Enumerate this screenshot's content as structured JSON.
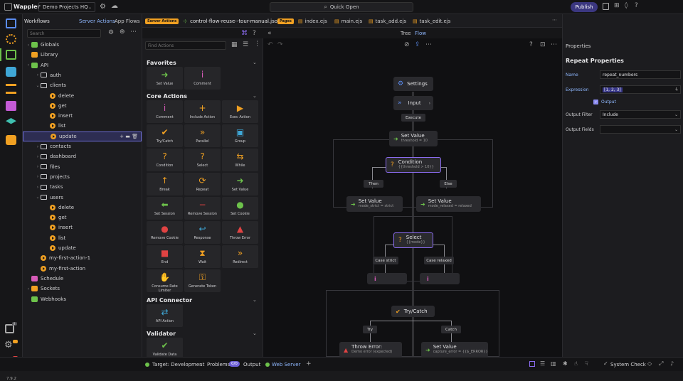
{
  "app": {
    "name": "Wappler",
    "project": "Demo Projects HQ",
    "quick_open": "Quick Open",
    "publish": "Publish",
    "version": "7.9.2"
  },
  "workflows": {
    "title": "Workflows",
    "tab_server": "Server Actions",
    "tab_flows": "App Flows",
    "search_placeholder": "Search",
    "tree": [
      {
        "label": "Globals",
        "kind": "globals",
        "depth": 0
      },
      {
        "label": "Library",
        "kind": "library",
        "depth": 0
      },
      {
        "label": "API",
        "kind": "api",
        "depth": 0
      },
      {
        "label": "auth",
        "kind": "folder",
        "depth": 1
      },
      {
        "label": "clients",
        "kind": "folder",
        "depth": 1
      },
      {
        "label": "delete",
        "kind": "action",
        "depth": 2
      },
      {
        "label": "get",
        "kind": "action",
        "depth": 2
      },
      {
        "label": "insert",
        "kind": "action",
        "depth": 2
      },
      {
        "label": "list",
        "kind": "action",
        "depth": 2
      },
      {
        "label": "update",
        "kind": "action",
        "depth": 2,
        "selected": true
      },
      {
        "label": "contacts",
        "kind": "folder",
        "depth": 1
      },
      {
        "label": "dashboard",
        "kind": "folder",
        "depth": 1
      },
      {
        "label": "files",
        "kind": "folder",
        "depth": 1
      },
      {
        "label": "projects",
        "kind": "folder",
        "depth": 1
      },
      {
        "label": "tasks",
        "kind": "folder",
        "depth": 1
      },
      {
        "label": "users",
        "kind": "folder",
        "depth": 1
      },
      {
        "label": "delete",
        "kind": "action",
        "depth": 2
      },
      {
        "label": "get",
        "kind": "action",
        "depth": 2
      },
      {
        "label": "insert",
        "kind": "action",
        "depth": 2
      },
      {
        "label": "list",
        "kind": "action",
        "depth": 2
      },
      {
        "label": "update",
        "kind": "action",
        "depth": 2
      },
      {
        "label": "my-first-action-1",
        "kind": "action",
        "depth": 1
      },
      {
        "label": "my-first-action",
        "kind": "action",
        "depth": 1
      },
      {
        "label": "Schedule",
        "kind": "schedule",
        "depth": 0
      },
      {
        "label": "Sockets",
        "kind": "sockets",
        "depth": 0
      },
      {
        "label": "Webhooks",
        "kind": "webhooks",
        "depth": 0
      }
    ]
  },
  "tabs": [
    {
      "badge": "Server Actions",
      "label": "control-flow-reuse--tour-manual.json",
      "active": true
    },
    {
      "badge": "Pages",
      "label": "index.ejs"
    },
    {
      "label": "main.ejs"
    },
    {
      "label": "task_add.ejs"
    },
    {
      "label": "task_edit.ejs"
    }
  ],
  "view_toggle": {
    "tree": "Tree",
    "flow": "Flow"
  },
  "actions": {
    "find_placeholder": "Find Actions",
    "favorites_title": "Favorites",
    "favorites": [
      {
        "label": "Set Value",
        "icon": "arrow",
        "color": "#6dc24b"
      },
      {
        "label": "Comment",
        "icon": "info",
        "color": "#d65bb8"
      }
    ],
    "core_title": "Core Actions",
    "core": [
      {
        "label": "Comment",
        "icon": "info",
        "color": "#d65bb8"
      },
      {
        "label": "Include Action",
        "icon": "plus",
        "color": "#f0a022"
      },
      {
        "label": "Exec Action",
        "icon": "play",
        "color": "#f0a022"
      },
      {
        "label": "Try/Catch",
        "icon": "check",
        "color": "#f0a022"
      },
      {
        "label": "Parallel",
        "icon": "dbl",
        "color": "#f0a022"
      },
      {
        "label": "Group",
        "icon": "group",
        "color": "#3fa7d6"
      },
      {
        "label": "Condition",
        "icon": "q",
        "color": "#f0a022"
      },
      {
        "label": "Select",
        "icon": "q",
        "color": "#f0a022"
      },
      {
        "label": "While",
        "icon": "loop",
        "color": "#f0a022"
      },
      {
        "label": "Break",
        "icon": "up",
        "color": "#f0a022"
      },
      {
        "label": "Repeat",
        "icon": "repeat",
        "color": "#f0a022"
      },
      {
        "label": "Set Value",
        "icon": "arrow",
        "color": "#6dc24b"
      },
      {
        "label": "Set Session",
        "icon": "arrowl",
        "color": "#6dc24b"
      },
      {
        "label": "Remove Session",
        "icon": "minus",
        "color": "#e04343"
      },
      {
        "label": "Set Cookie",
        "icon": "cookie",
        "color": "#6dc24b"
      },
      {
        "label": "Remove Cookie",
        "icon": "cookie",
        "color": "#e04343"
      },
      {
        "label": "Response",
        "icon": "send",
        "color": "#3fa7d6"
      },
      {
        "label": "Throw Error",
        "icon": "warn",
        "color": "#e04343"
      },
      {
        "label": "End",
        "icon": "stop",
        "color": "#e04343"
      },
      {
        "label": "Wait",
        "icon": "hour",
        "color": "#f0a022"
      },
      {
        "label": "Redirect",
        "icon": "dbl",
        "color": "#f0a022"
      },
      {
        "label": "Consume Rate Limiter",
        "icon": "hand",
        "color": "#f0a022"
      },
      {
        "label": "Generate Token",
        "icon": "key",
        "color": "#f0a022"
      }
    ],
    "api_title": "API Connector",
    "api": [
      {
        "label": "API Action",
        "icon": "swap",
        "color": "#3fa7d6"
      }
    ],
    "validator_title": "Validator",
    "validator": [
      {
        "label": "Validate Data",
        "icon": "tick",
        "color": "#6dc24b"
      }
    ]
  },
  "flow": {
    "settings": "Settings",
    "input": "Input",
    "execute": "Execute",
    "sv1_title": "Set Value",
    "sv1_sub": "threshold = 10",
    "cond_title": "Condition",
    "cond_sub": "{{threshold > 10}}",
    "then": "Then",
    "else": "Else",
    "sv2_title": "Set Value",
    "sv2_sub": "mode_strict = strict",
    "sv3_title": "Set Value",
    "sv3_sub": "mode_relaxed = relaxed",
    "sel_title": "Select",
    "sel_sub": "{{mode}}",
    "case1": "Case strict",
    "case2": "Case relaxed",
    "try_title": "Try/Catch",
    "try": "Try",
    "catch": "Catch",
    "err_title": "Throw Error:",
    "err_sub": "Demo error (expected)",
    "sv4_title": "Set Value",
    "sv4_sub": "capture_error = {{$_ERROR}}"
  },
  "properties": {
    "title": "Properties",
    "section": "Repeat Properties",
    "name_label": "Name",
    "name_value": "repeat_numbers",
    "expr_label": "Expression",
    "expr_value": "[1, 2, 3]",
    "output_label": "Output",
    "filter_label": "Output Filter",
    "filter_value": "Include",
    "fields_label": "Output Fields",
    "fields_value": ""
  },
  "status": {
    "target": "Target: Development",
    "problems": "Problems",
    "problems_count": "0/0",
    "output": "Output",
    "webserver": "Web Server",
    "system_check": "System Check"
  },
  "colors": {
    "accent": "#f0a022",
    "green": "#6dc24b",
    "blue": "#5b8cf0",
    "purple": "#8b6cf0"
  }
}
